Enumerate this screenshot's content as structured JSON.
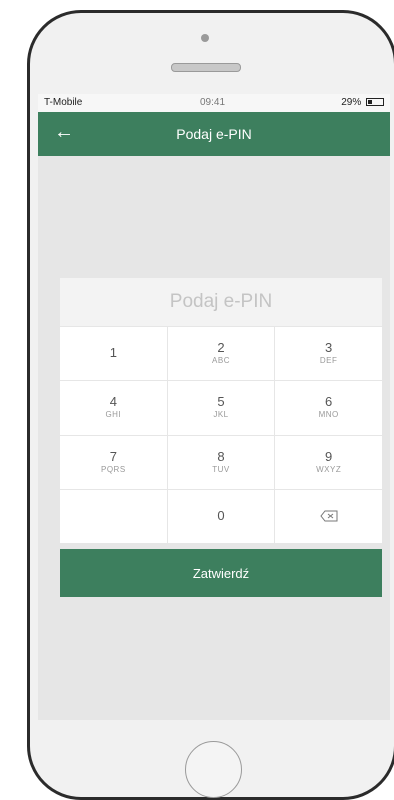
{
  "status": {
    "carrier": "T-Mobile",
    "time": "09:41",
    "battery": "29%"
  },
  "header": {
    "title": "Podaj e-PIN",
    "back_icon": "arrow-left-icon"
  },
  "pin": {
    "placeholder": "Podaj e-PIN",
    "value": ""
  },
  "keypad": {
    "keys": [
      {
        "digit": "1",
        "letters": ""
      },
      {
        "digit": "2",
        "letters": "ABC"
      },
      {
        "digit": "3",
        "letters": "DEF"
      },
      {
        "digit": "4",
        "letters": "GHI"
      },
      {
        "digit": "5",
        "letters": "JKL"
      },
      {
        "digit": "6",
        "letters": "MNO"
      },
      {
        "digit": "7",
        "letters": "PQRS"
      },
      {
        "digit": "8",
        "letters": "TUV"
      },
      {
        "digit": "9",
        "letters": "WXYZ"
      },
      {
        "digit": "0",
        "letters": ""
      }
    ],
    "delete_icon": "backspace-icon"
  },
  "confirm": {
    "label": "Zatwierdź"
  },
  "colors": {
    "accent": "#3d7f5e",
    "screen_bg": "#e6e6e6"
  }
}
